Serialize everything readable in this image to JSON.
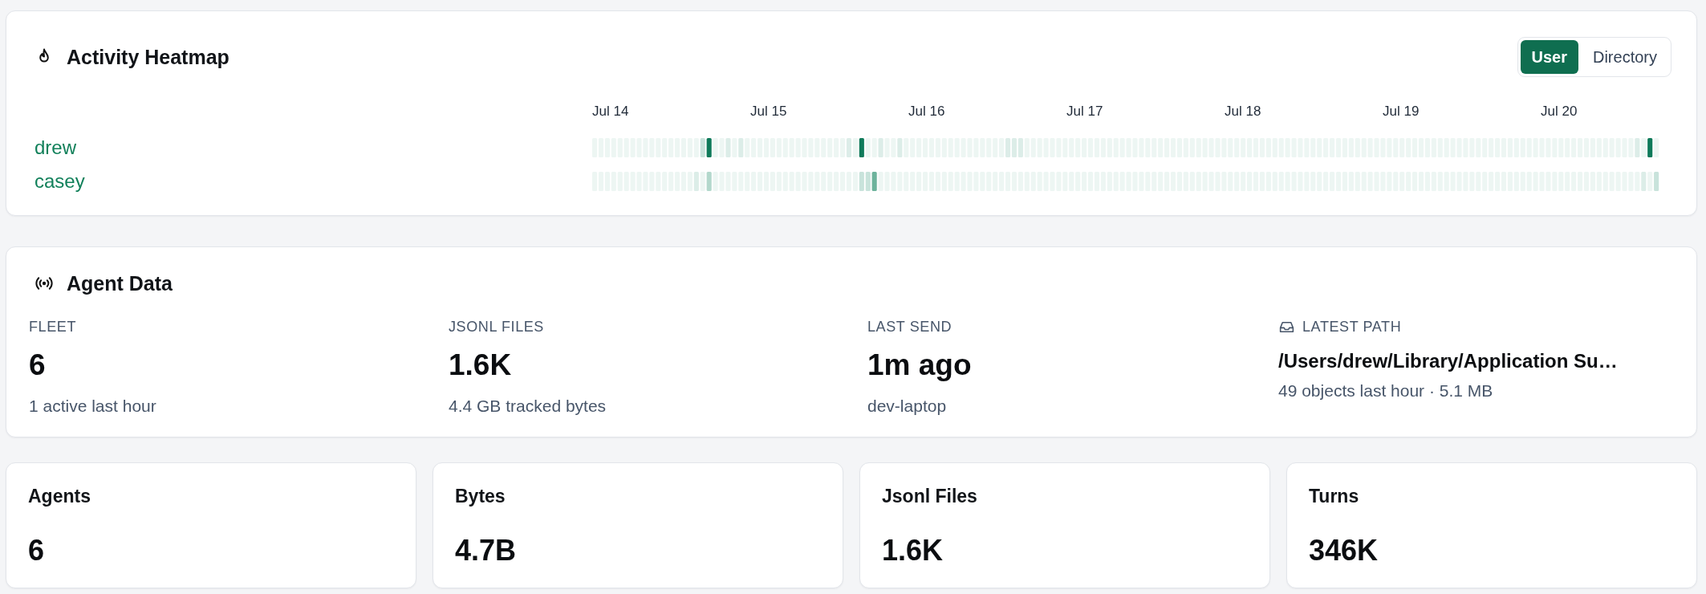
{
  "heatmap": {
    "title": "Activity Heatmap",
    "toggle": [
      {
        "label": "User",
        "selected": true
      },
      {
        "label": "Directory",
        "selected": false
      }
    ],
    "dates": [
      "Jul 14",
      "Jul 15",
      "Jul 16",
      "Jul 17",
      "Jul 18",
      "Jul 19",
      "Jul 20"
    ],
    "rows": [
      {
        "name": "drew"
      },
      {
        "name": "casey"
      }
    ]
  },
  "agent_data": {
    "title": "Agent Data",
    "stats": [
      {
        "kind": "metric",
        "label": "FLEET",
        "value": "6",
        "detail": "1 active last hour"
      },
      {
        "kind": "metric",
        "label": "JSONL FILES",
        "value": "1.6K",
        "detail": "4.4 GB tracked bytes"
      },
      {
        "kind": "metric",
        "label": "LAST SEND",
        "value": "1m ago",
        "detail": "dev-laptop"
      },
      {
        "kind": "path",
        "label": "LATEST PATH",
        "value": "/Users/drew/Library/Application Su…",
        "detail": "49 objects last hour · 5.1 MB"
      }
    ]
  },
  "summary_cards": [
    {
      "title": "Agents",
      "value": "6"
    },
    {
      "title": "Bytes",
      "value": "4.7B"
    },
    {
      "title": "Jsonl Files",
      "value": "1.6K"
    },
    {
      "title": "Turns",
      "value": "346K"
    }
  ]
}
